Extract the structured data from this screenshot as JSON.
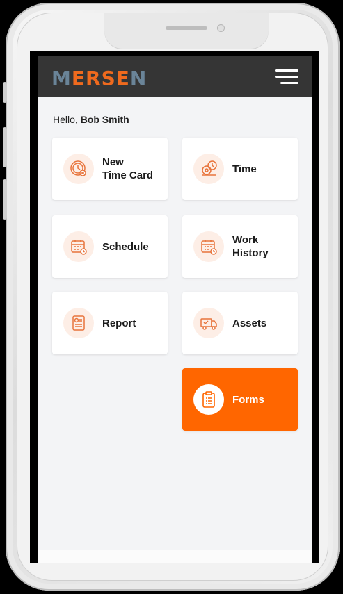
{
  "header": {
    "logo_text": "MERSEN",
    "menu_icon": "hamburger-menu-icon"
  },
  "greeting": {
    "prefix": "Hello, ",
    "user_name": "Bob Smith"
  },
  "tiles": [
    {
      "label": "New\nTime Card",
      "icon": "clock-add-icon"
    },
    {
      "label": "Time",
      "icon": "time-settings-icon"
    },
    {
      "label": "Schedule",
      "icon": "calendar-clock-icon"
    },
    {
      "label": "Work\nHistory",
      "icon": "calendar-history-icon"
    },
    {
      "label": "Report",
      "icon": "report-document-icon"
    },
    {
      "label": "Assets",
      "icon": "delivery-truck-icon"
    },
    {
      "label": "Forms",
      "icon": "clipboard-list-icon",
      "active": true
    }
  ],
  "colors": {
    "accent": "#ff6600",
    "header_bg": "#353535",
    "icon_bg": "#fdeee6",
    "page_bg": "#f3f4f6"
  }
}
